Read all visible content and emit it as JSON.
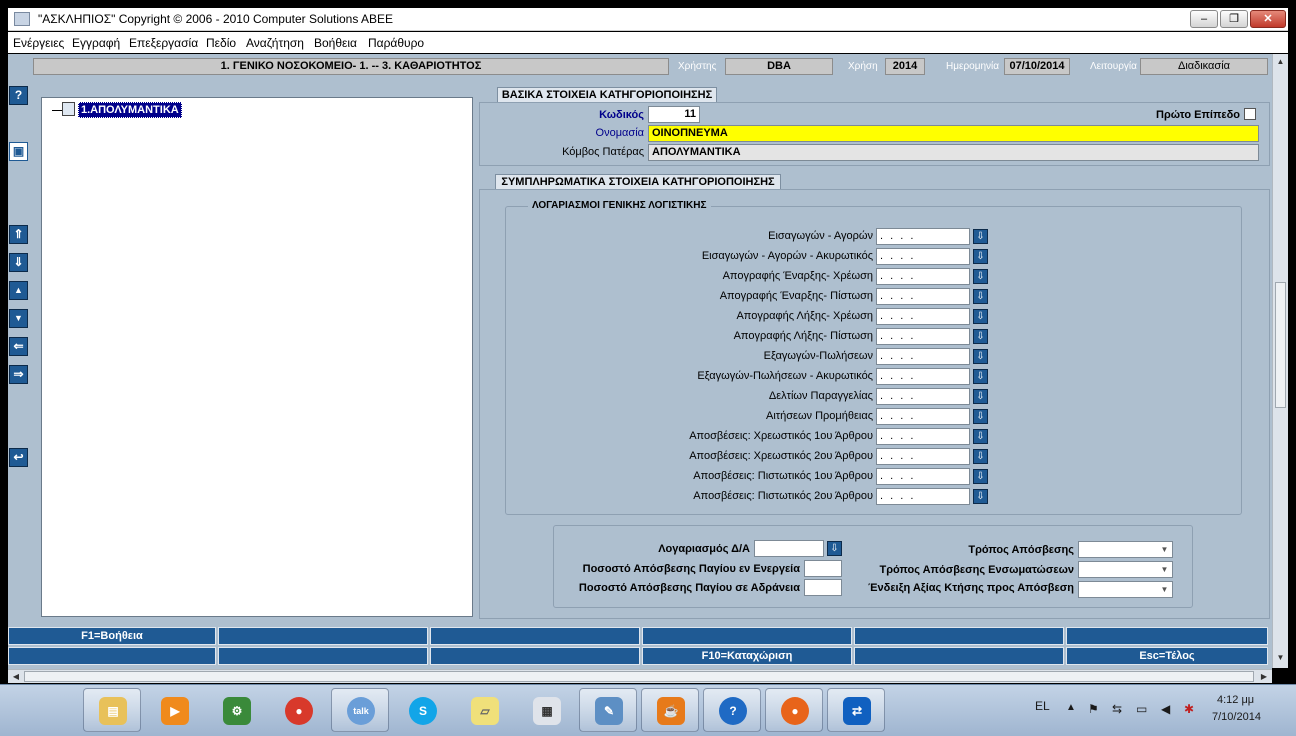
{
  "window": {
    "title": "\"ΑΣΚΛΗΠΙΟΣ\" Copyright © 2006 - 2010 Computer Solutions ABEE",
    "minimize": "–",
    "restore": "❐",
    "close": "✕"
  },
  "menu": [
    "Ενέργειες",
    "Εγγραφή",
    "Επεξεργασία",
    "Πεδίο",
    "Αναζήτηση",
    "Βοήθεια",
    "Παράθυρο"
  ],
  "info": {
    "org": "1. ΓΕΝΙΚΟ ΝΟΣΟΚΟΜΕΙΟ- 1. -- 3. ΚΑΘΑΡΙΟΤΗΤΟΣ",
    "user_label": "Χρήστης",
    "user": "DBA",
    "year_label": "Χρήση",
    "year": "2014",
    "date_label": "Ημερομηνία",
    "date": "07/10/2014",
    "mode_label": "Λειτουργία",
    "mode": "Διαδικασία"
  },
  "tools": {
    "help": "?",
    "save": "▣",
    "first": "⇑",
    "last": "⇓",
    "prev": "▲",
    "next": "▼",
    "left": "⇐",
    "right": "⇒",
    "undo": "↩"
  },
  "tree": {
    "node": "1.ΑΠΟΛΥΜΑΝΤΙΚΑ"
  },
  "basic": {
    "header": "ΒΑΣΙΚΑ ΣΤΟΙΧΕΙΑ ΚΑΤΗΓΟΡΙΟΠΟΙΗΣΗΣ",
    "code_label": "Κωδικός",
    "code": "11",
    "first_level_label": "Πρώτο Επίπεδο",
    "name_label": "Ονομασία",
    "name": "ΟΙΝΟΠΝΕΥΜΑ",
    "parent_label": "Κόμβος Πατέρας",
    "parent": "ΑΠΟΛΥΜΑΝΤΙΚΑ"
  },
  "extra": {
    "header": "ΣΥΜΠΛΗΡΩΜΑΤΙΚΑ ΣΤΟΙΧΕΙΑ ΚΑΤΗΓΟΡΙΟΠΟΙΗΣΗΣ",
    "accounts_header": "ΛΟΓΑΡΙΑΣΜΟΙ ΓΕΝΙΚΗΣ ΛΟΓΙΣΤΙΚΗΣ",
    "account_value": ".     .     .     .",
    "accounts": [
      "Εισαγωγών - Αγορών",
      "Εισαγωγών - Αγορών  - Ακυρωτικός",
      "Απογραφής Έναρξης- Χρέωση",
      "Απογραφής Έναρξης- Πίστωση",
      "Απογραφής Λήξης- Χρέωση",
      "Απογραφής Λήξης- Πίστωση",
      "Εξαγωγών-Πωλήσεων",
      "Εξαγωγών-Πωλήσεων - Ακυρωτικός",
      "Δελτίων Παραγγελίας",
      "Αιτήσεων Προμήθειας",
      "Αποσβέσεις: Χρεωστικός 1ου Άρθρου",
      "Αποσβέσεις: Χρεωστικός 2ου Άρθρου",
      "Αποσβέσεις: Πιστωτικός 1ου Άρθρου",
      "Αποσβέσεις: Πιστωτικός 2ου Άρθρου"
    ]
  },
  "depr": {
    "account_label": "Λογαριασμός Δ/Α",
    "active_label": "Ποσοστό Απόσβεσης Παγίου εν Ενεργεία",
    "idle_label": "Ποσοστό Απόσβεσης Παγίου σε Αδράνεια",
    "method_label": "Τρόπος Απόσβεσης",
    "method_inc_label": "Τρόπος Απόσβεσης Ενσωματώσεων",
    "value_label": "Ένδειξη Αξίας Κτήσης προς Απόσβεση"
  },
  "fkeys": {
    "f1": "F1=Βοήθεια",
    "f10": "F10=Καταχώριση",
    "esc": "Esc=Τέλος"
  },
  "taskbar": {
    "lang": "EL",
    "time": "4:12 μμ",
    "date": "7/10/2014",
    "apps": [
      "folder-icon",
      "media-player-icon",
      "network-icon",
      "chrome-icon",
      "talk-icon",
      "skype-icon",
      "sticky-notes-icon",
      "calculator-icon",
      "notepad-icon",
      "java-icon",
      "help-icon",
      "firefox-icon",
      "teamviewer-icon"
    ]
  }
}
